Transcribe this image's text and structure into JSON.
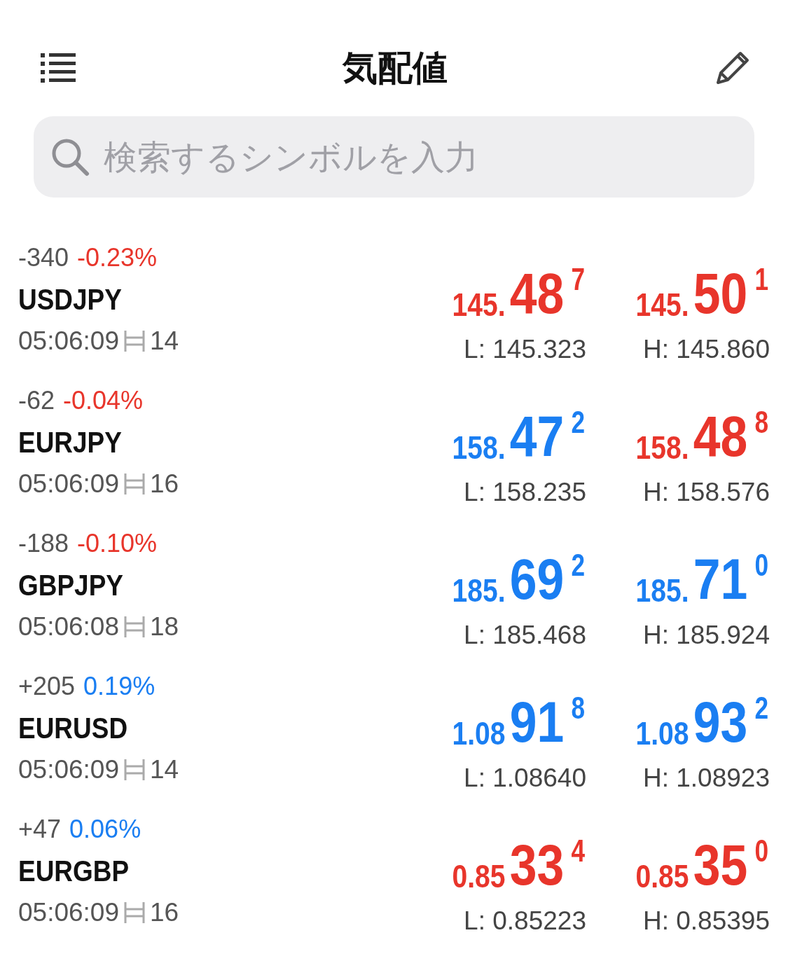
{
  "header": {
    "title": "気配値"
  },
  "search": {
    "placeholder": "検索するシンボルを入力"
  },
  "quotes": [
    {
      "change": "-340",
      "percent": "-0.23%",
      "color": "#e8352b",
      "symbol": "USDJPY",
      "time": "05:06:09",
      "spread": "14",
      "bid": {
        "small": "145.",
        "big": "48",
        "sup": "7",
        "color": "#e8352b"
      },
      "ask": {
        "small": "145.",
        "big": "50",
        "sup": "1",
        "color": "#e8352b"
      },
      "low": "L: 145.323",
      "high": "H: 145.860"
    },
    {
      "change": "-62",
      "percent": "-0.04%",
      "color": "#e8352b",
      "symbol": "EURJPY",
      "time": "05:06:09",
      "spread": "16",
      "bid": {
        "small": "158.",
        "big": "47",
        "sup": "2",
        "color": "#1a7ef2"
      },
      "ask": {
        "small": "158.",
        "big": "48",
        "sup": "8",
        "color": "#e8352b"
      },
      "low": "L: 158.235",
      "high": "H: 158.576"
    },
    {
      "change": "-188",
      "percent": "-0.10%",
      "color": "#e8352b",
      "symbol": "GBPJPY",
      "time": "05:06:08",
      "spread": "18",
      "bid": {
        "small": "185.",
        "big": "69",
        "sup": "2",
        "color": "#1a7ef2"
      },
      "ask": {
        "small": "185.",
        "big": "71",
        "sup": "0",
        "color": "#1a7ef2"
      },
      "low": "L: 185.468",
      "high": "H: 185.924"
    },
    {
      "change": "+205",
      "percent": "0.19%",
      "color": "#1a7ef2",
      "symbol": "EURUSD",
      "time": "05:06:09",
      "spread": "14",
      "bid": {
        "small": "1.08",
        "big": "91",
        "sup": "8",
        "color": "#1a7ef2"
      },
      "ask": {
        "small": "1.08",
        "big": "93",
        "sup": "2",
        "color": "#1a7ef2"
      },
      "low": "L: 1.08640",
      "high": "H: 1.08923"
    },
    {
      "change": "+47",
      "percent": "0.06%",
      "color": "#1a7ef2",
      "symbol": "EURGBP",
      "time": "05:06:09",
      "spread": "16",
      "bid": {
        "small": "0.85",
        "big": "33",
        "sup": "4",
        "color": "#e8352b"
      },
      "ask": {
        "small": "0.85",
        "big": "35",
        "sup": "0",
        "color": "#e8352b"
      },
      "low": "L: 0.85223",
      "high": "H: 0.85395"
    }
  ]
}
